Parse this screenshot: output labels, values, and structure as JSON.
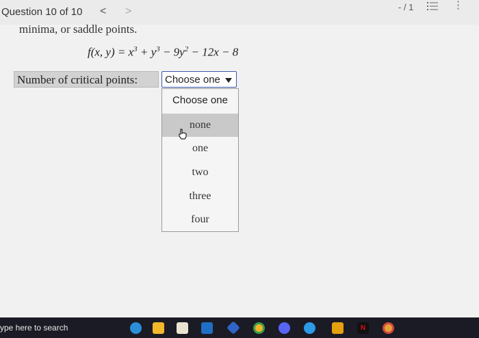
{
  "header": {
    "question_counter": "Question 10 of 10",
    "prev_glyph": "<",
    "next_glyph": ">",
    "score": "- / 1",
    "list_icon": "list-icon",
    "more_glyph": "⋮"
  },
  "question": {
    "lead_text": "minima, or saddle points.",
    "formula": {
      "lhs": "f(x, y) = x",
      "exp1": "3",
      "plus_y": " + y",
      "exp2": "3",
      "minus_9y": " − 9y",
      "exp3": "2",
      "tail": " − 12x − 8"
    },
    "prompt_label": "Number of critical points:",
    "select": {
      "selected": "Choose one"
    },
    "options": [
      "Choose one",
      "none",
      "one",
      "two",
      "three",
      "four"
    ],
    "highlighted_option": "none"
  },
  "taskbar": {
    "search_placeholder": "ype here to search",
    "icons": [
      "edge-icon",
      "file-explorer-icon",
      "store-icon",
      "mail-icon",
      "photos-icon",
      "chrome-icon",
      "discord-icon",
      "teams-icon",
      "plex-icon",
      "netflix-icon",
      "chrome-canary-icon"
    ],
    "netflix_label": "N"
  },
  "colors": {
    "select_border": "#3b56a8",
    "prompt_bg": "#d2d2d2",
    "highlight_bg": "#c9c9c9",
    "taskbar_bg": "#1b1b26"
  }
}
